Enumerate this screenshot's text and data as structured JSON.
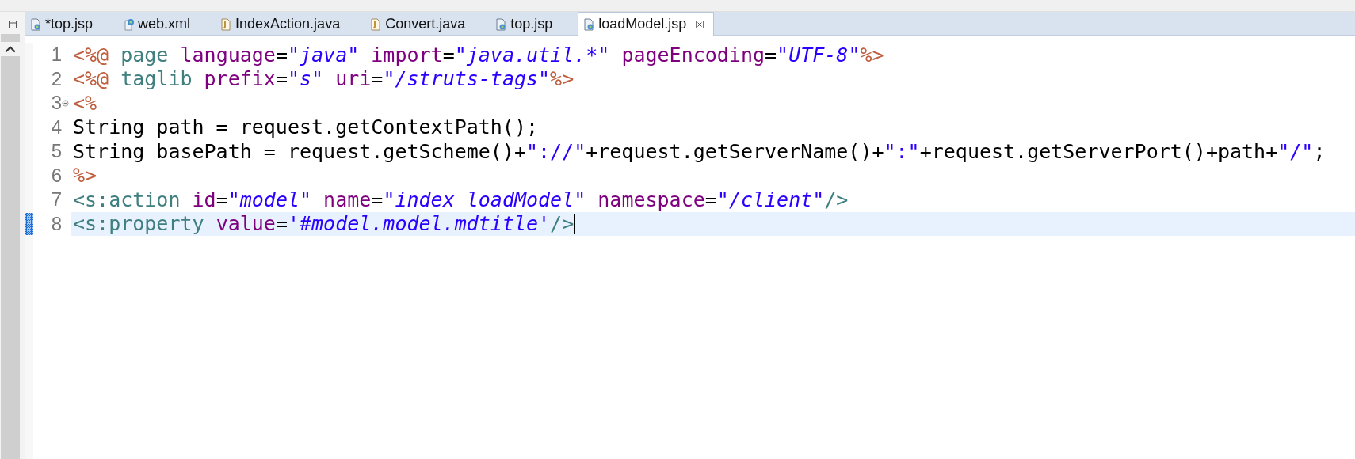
{
  "tabs": [
    {
      "label": "*top.jsp",
      "kind": "jsp",
      "selected": false
    },
    {
      "label": "web.xml",
      "kind": "xml",
      "selected": false
    },
    {
      "label": "IndexAction.java",
      "kind": "java",
      "selected": false
    },
    {
      "label": "Convert.java",
      "kind": "java",
      "selected": false
    },
    {
      "label": "top.jsp",
      "kind": "jsp",
      "selected": false
    },
    {
      "label": "loadModel.jsp",
      "kind": "jsp",
      "selected": true
    }
  ],
  "editor": {
    "lines": [
      {
        "number": "1",
        "current": false,
        "foldable": false,
        "tokens": [
          {
            "kind": "delim",
            "text": "<%@"
          },
          {
            "kind": "tag",
            "text": " page"
          },
          {
            "kind": "attr",
            "text": " language"
          },
          {
            "kind": "plain",
            "text": "="
          },
          {
            "kind": "value",
            "text": "\"java\""
          },
          {
            "kind": "attr",
            "text": " import"
          },
          {
            "kind": "plain",
            "text": "="
          },
          {
            "kind": "value",
            "text": "\"java.util.*\""
          },
          {
            "kind": "attr",
            "text": " pageEncoding"
          },
          {
            "kind": "plain",
            "text": "="
          },
          {
            "kind": "value",
            "text": "\"UTF-8\""
          },
          {
            "kind": "delim",
            "text": "%>"
          }
        ]
      },
      {
        "number": "2",
        "current": false,
        "foldable": false,
        "tokens": [
          {
            "kind": "delim",
            "text": "<%@"
          },
          {
            "kind": "tag",
            "text": " taglib"
          },
          {
            "kind": "attr",
            "text": " prefix"
          },
          {
            "kind": "plain",
            "text": "="
          },
          {
            "kind": "value",
            "text": "\"s\""
          },
          {
            "kind": "attr",
            "text": " uri"
          },
          {
            "kind": "plain",
            "text": "="
          },
          {
            "kind": "value",
            "text": "\"/struts-tags\""
          },
          {
            "kind": "delim",
            "text": "%>"
          }
        ]
      },
      {
        "number": "3",
        "current": false,
        "foldable": true,
        "tokens": [
          {
            "kind": "delim",
            "text": "<%"
          }
        ]
      },
      {
        "number": "4",
        "current": false,
        "foldable": false,
        "tokens": [
          {
            "kind": "plain",
            "text": "String path = request.getContextPath();"
          }
        ]
      },
      {
        "number": "5",
        "current": false,
        "foldable": false,
        "tokens": [
          {
            "kind": "plain",
            "text": "String basePath = request.getScheme()+"
          },
          {
            "kind": "string",
            "text": "\"://\""
          },
          {
            "kind": "plain",
            "text": "+request.getServerName()+"
          },
          {
            "kind": "string",
            "text": "\":\""
          },
          {
            "kind": "plain",
            "text": "+request.getServerPort()+path+"
          },
          {
            "kind": "string",
            "text": "\"/\""
          },
          {
            "kind": "plain",
            "text": ";"
          }
        ]
      },
      {
        "number": "6",
        "current": false,
        "foldable": false,
        "tokens": [
          {
            "kind": "delim",
            "text": "%>"
          }
        ]
      },
      {
        "number": "7",
        "current": false,
        "foldable": false,
        "tokens": [
          {
            "kind": "tag",
            "text": "<s:action"
          },
          {
            "kind": "attr",
            "text": " id"
          },
          {
            "kind": "plain",
            "text": "="
          },
          {
            "kind": "value",
            "text": "\"model\""
          },
          {
            "kind": "attr",
            "text": " name"
          },
          {
            "kind": "plain",
            "text": "="
          },
          {
            "kind": "value",
            "text": "\"index_loadModel\""
          },
          {
            "kind": "attr",
            "text": " namespace"
          },
          {
            "kind": "plain",
            "text": "="
          },
          {
            "kind": "value",
            "text": "\"/client\""
          },
          {
            "kind": "tag",
            "text": "/>"
          }
        ]
      },
      {
        "number": "8",
        "current": true,
        "foldable": false,
        "tokens": [
          {
            "kind": "tag",
            "text": "<s:property"
          },
          {
            "kind": "attr",
            "text": " value"
          },
          {
            "kind": "plain",
            "text": "="
          },
          {
            "kind": "value",
            "text": "'#model.model.mdtitle'"
          },
          {
            "kind": "tag",
            "text": "/>"
          }
        ]
      }
    ]
  }
}
